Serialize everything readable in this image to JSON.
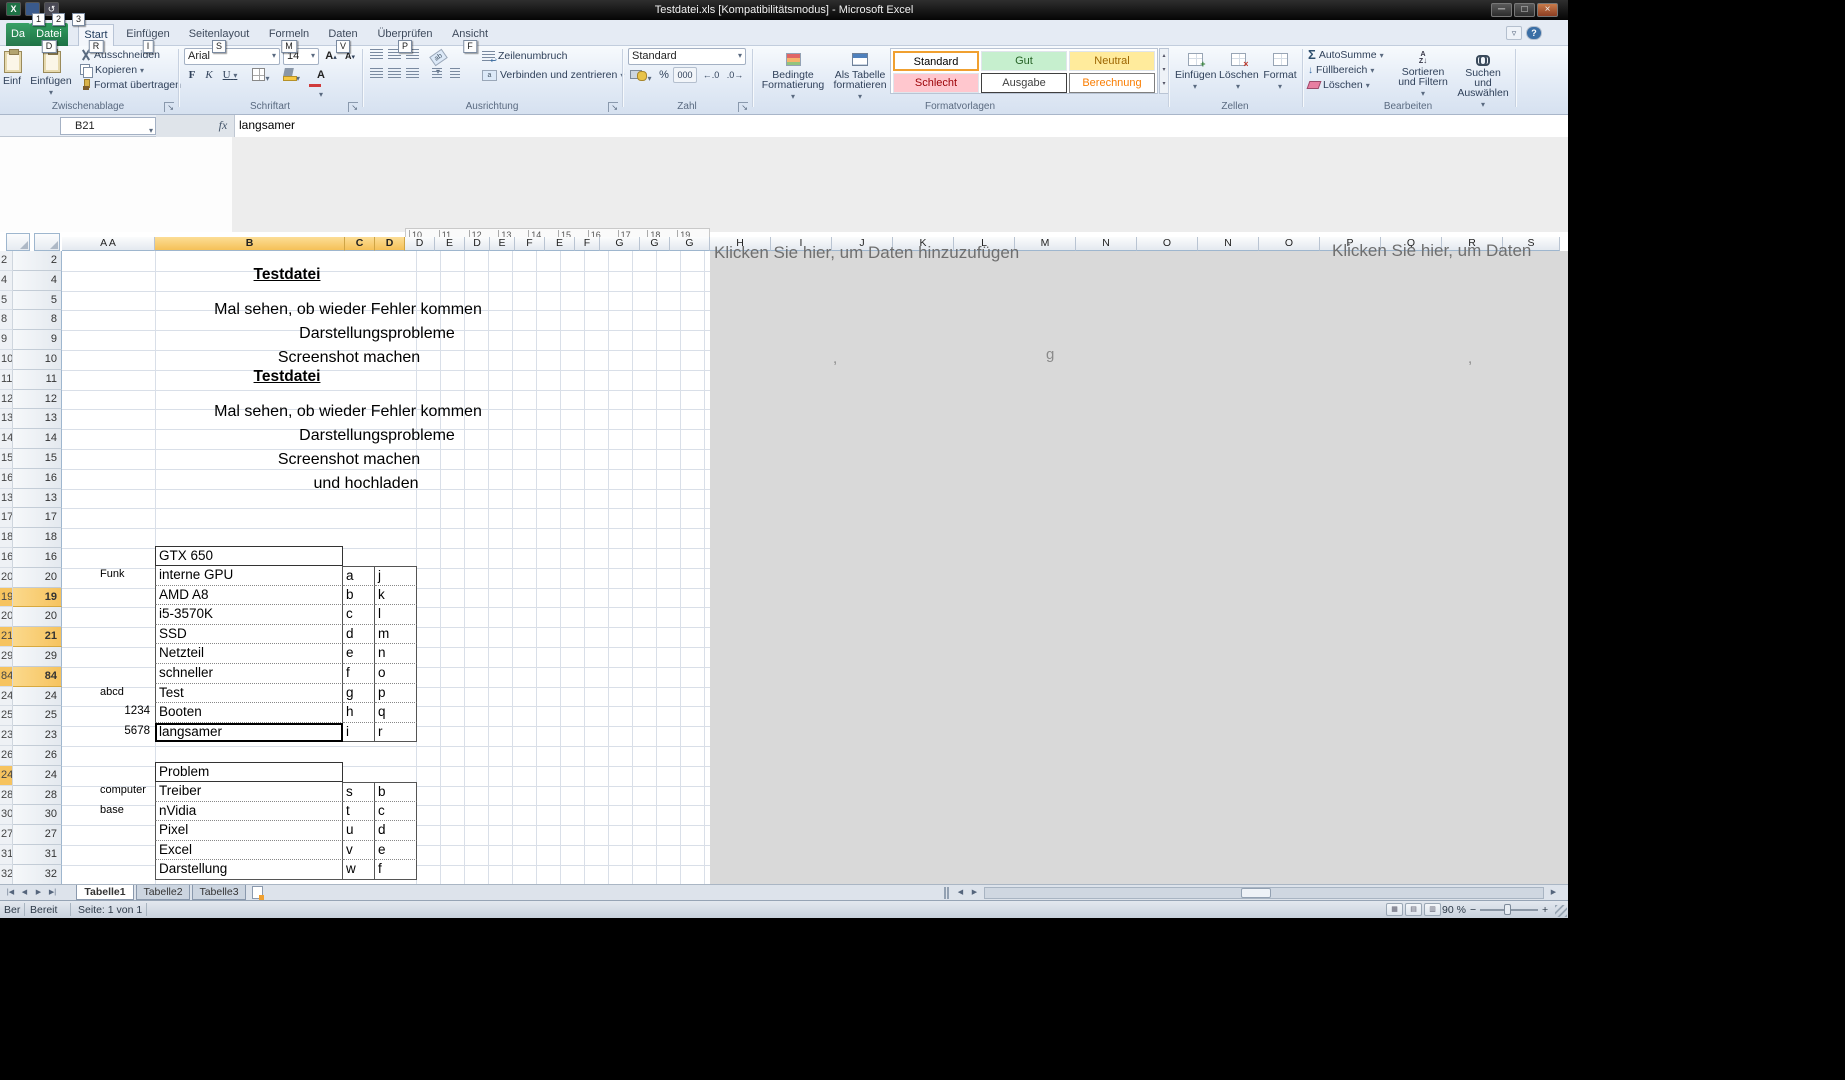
{
  "window": {
    "title": "Testdatei.xls  [Kompatibilitätsmodus]  -  Microsoft Excel",
    "controls": {
      "minimize": "─",
      "maximize": "□",
      "close": "×"
    },
    "qat_keytips": [
      "1",
      "2",
      "3"
    ],
    "help": "?"
  },
  "ribbon": {
    "file_tab": "Datei",
    "file_tab_ghost": "Da",
    "file_keytip": "D",
    "tabs": [
      {
        "label": "Start",
        "keytip": "R"
      },
      {
        "label": "Einfügen",
        "keytip": "I"
      },
      {
        "label": "Seitenlayout",
        "keytip": "S"
      },
      {
        "label": "Formeln",
        "keytip": "M"
      },
      {
        "label": "Daten",
        "keytip": "V"
      },
      {
        "label": "Überprüfen",
        "keytip": "P"
      },
      {
        "label": "Ansicht",
        "keytip": "F"
      }
    ],
    "clipboard": {
      "label": "Zwischenablage",
      "paste": "Einfügen",
      "paste_ghost": "Einf",
      "cut": "Ausschneiden",
      "copy": "Kopieren",
      "format_painter": "Format übertragen"
    },
    "font": {
      "label": "Schriftart",
      "name": "Arial",
      "size": "14",
      "bold": "F",
      "italic": "K",
      "underline": "U",
      "grow": "A",
      "shrink": "A"
    },
    "alignment": {
      "label": "Ausrichtung",
      "wrap": "Zeilenumbruch",
      "merge": "Verbinden und zentrieren"
    },
    "number": {
      "label": "Zahl",
      "format": "Standard",
      "percent": "%",
      "thousands": "000"
    },
    "styles": {
      "label": "Formatvorlagen",
      "conditional": "Bedingte Formatierung",
      "as_table": "Als Tabelle formatieren",
      "gallery": [
        "Standard",
        "Gut",
        "Neutral",
        "Schlecht",
        "Ausgabe",
        "Berechnung"
      ]
    },
    "cells": {
      "label": "Zellen",
      "insert": "Einfügen",
      "delete": "Löschen",
      "format": "Format"
    },
    "editing": {
      "label": "Bearbeiten",
      "autosum": "AutoSumme",
      "fill": "Füllbereich",
      "clear": "Löschen",
      "sort": "Sortieren und Filtern",
      "find": "Suchen und Auswählen"
    }
  },
  "formula_bar": {
    "name_box": "B21",
    "fx_label": "fx",
    "content": "langsamer"
  },
  "sheet": {
    "ruler_numbers": [
      "10",
      "11",
      "12",
      "13",
      "14",
      "15",
      "16",
      "17",
      "18",
      "19"
    ],
    "col_headers": [
      "A A",
      "B",
      "C",
      "D",
      "D",
      "E",
      "D",
      "E",
      "F",
      "E",
      "F",
      "G",
      "G",
      "G",
      "H",
      "I",
      "J",
      "K",
      "L",
      "M",
      "N",
      "O",
      "N",
      "O",
      "P",
      "Q",
      "R",
      "S"
    ],
    "selected_cols": [
      1,
      2,
      3
    ],
    "row_headers": [
      {
        "n": "2"
      },
      {
        "n": "4"
      },
      {
        "n": "5"
      },
      {
        "n": "8"
      },
      {
        "n": "9"
      },
      {
        "n": "10"
      },
      {
        "n": "11"
      },
      {
        "n": "12"
      },
      {
        "n": "13"
      },
      {
        "n": "14"
      },
      {
        "n": "15"
      },
      {
        "n": "16"
      },
      {
        "n": "13"
      },
      {
        "n": "17"
      },
      {
        "n": "18"
      },
      {
        "n": "16"
      },
      {
        "n": "20"
      },
      {
        "n": "19",
        "hl": true
      },
      {
        "n": "20"
      },
      {
        "n": "21",
        "hl": true
      },
      {
        "n": "29"
      },
      {
        "n": "84",
        "hl": true
      },
      {
        "n": "24"
      },
      {
        "n": "25"
      },
      {
        "n": "23"
      },
      {
        "n": "26"
      },
      {
        "n": "24",
        "hlg": true
      },
      {
        "n": "28"
      },
      {
        "n": "30"
      },
      {
        "n": "27"
      },
      {
        "n": "31"
      },
      {
        "n": "32"
      }
    ],
    "text_lines": [
      {
        "text": "Testdatei",
        "style": "title"
      },
      {
        "text": "Mal sehen, ob wieder Fehler kommen"
      },
      {
        "text": "Darstellungsprobleme"
      },
      {
        "text": "Screenshot machen"
      },
      {
        "text": "Testdatei",
        "style": "title"
      },
      {
        "text": "Mal sehen, ob wieder Fehler kommen"
      },
      {
        "text": "Darstellungsprobleme"
      },
      {
        "text": "Screenshot machen"
      },
      {
        "text": "und hochladen"
      }
    ],
    "table1": {
      "header": "GTX 650",
      "rows": [
        {
          "label": "interne GPU",
          "c1": "a",
          "c2": "j",
          "side": "Funk"
        },
        {
          "label": "AMD A8",
          "c1": "b",
          "c2": "k"
        },
        {
          "label": "i5-3570K",
          "c1": "c",
          "c2": "l"
        },
        {
          "label": "SSD",
          "c1": "d",
          "c2": "m"
        },
        {
          "label": "Netzteil",
          "c1": "e",
          "c2": "n"
        },
        {
          "label": "schneller",
          "c1": "f",
          "c2": "o"
        },
        {
          "label": "Test",
          "c1": "g",
          "c2": "p",
          "side": "abcd"
        },
        {
          "label": "Booten",
          "c1": "h",
          "c2": "q",
          "side": "1234"
        },
        {
          "label": "langsamer",
          "c1": "i",
          "c2": "r",
          "side": "5678",
          "selected": true
        }
      ]
    },
    "table2": {
      "header": "Problem",
      "rows": [
        {
          "label": "Treiber",
          "c1": "s",
          "c2": "b",
          "side": "computer"
        },
        {
          "label": "nVidia",
          "c1": "t",
          "c2": "c",
          "side": "base"
        },
        {
          "label": "Pixel",
          "c1": "u",
          "c2": "d"
        },
        {
          "label": "Excel",
          "c1": "v",
          "c2": "e"
        },
        {
          "label": "Darstellung",
          "c1": "w",
          "c2": "f"
        }
      ]
    },
    "chart_placeholder_1": "Klicken Sie hier, um Daten hinzuzufügen",
    "chart_placeholder_2": "Klicken Sie hier, um Daten",
    "ghost_fragments": [
      ",",
      "g",
      ","
    ]
  },
  "sheet_tabs": {
    "active": "Tabelle1",
    "others": [
      "Tabelle2",
      "Tabelle3"
    ]
  },
  "status_bar": {
    "mode_ghost": "Ber",
    "mode": "Bereit",
    "page": "Seite: 1 von 1",
    "zoom": "90 %"
  }
}
